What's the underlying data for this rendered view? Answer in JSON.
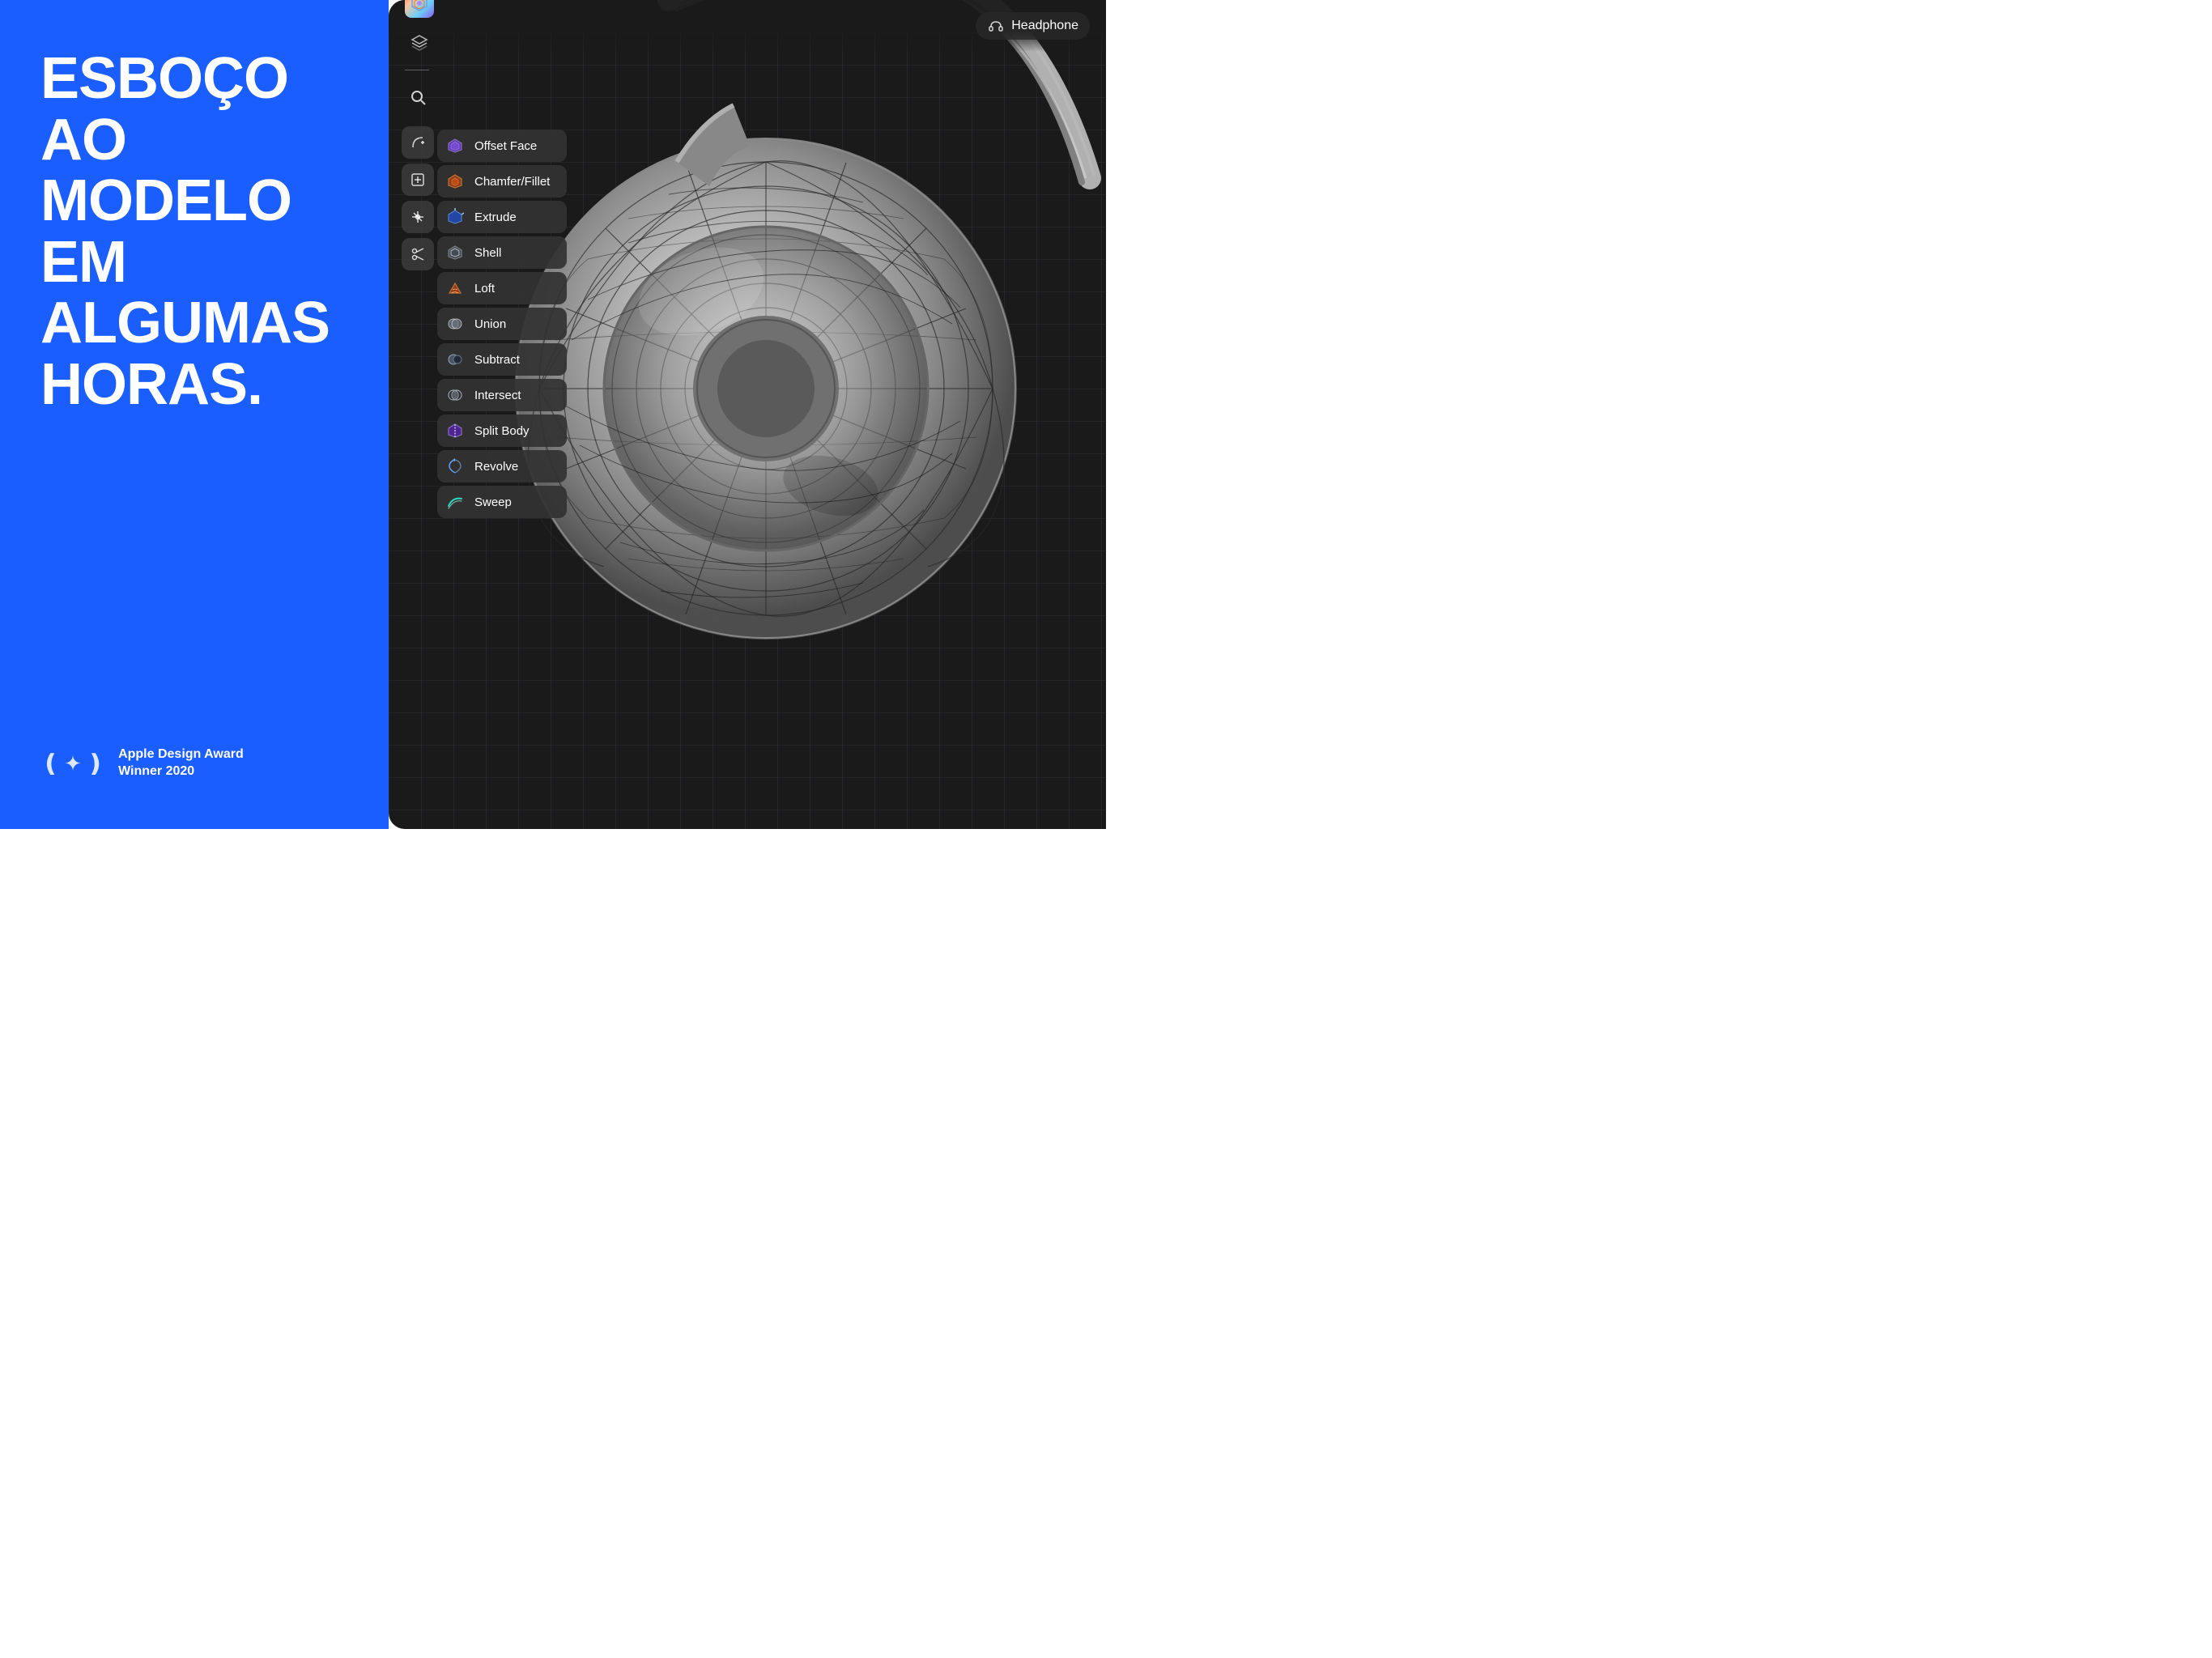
{
  "left": {
    "headline": "ESBOÇO AO MODELO EM ALGUMAS HORAS.",
    "award": {
      "title": "Apple Design Award",
      "subtitle": "Winner 2020"
    }
  },
  "right": {
    "app_icon": "◈",
    "layers_icon": "⊞",
    "model_name": "Headphone",
    "toolbar": {
      "search_label": "Search",
      "tools": [
        {
          "name": "add-constraint-tool",
          "label": "+"
        },
        {
          "name": "add-tool",
          "label": "+"
        },
        {
          "name": "transform-tool",
          "label": "✛"
        },
        {
          "name": "scissors-tool",
          "label": "✂"
        }
      ]
    },
    "menu_items": [
      {
        "id": "offset-face",
        "label": "Offset Face",
        "icon": "⬡",
        "icon_class": "icon-purple"
      },
      {
        "id": "chamfer-fillet",
        "label": "Chamfer/Fillet",
        "icon": "⬡",
        "icon_class": "icon-orange"
      },
      {
        "id": "extrude",
        "label": "Extrude",
        "icon": "⬡",
        "icon_class": "icon-blue"
      },
      {
        "id": "shell",
        "label": "Shell",
        "icon": "⬡",
        "icon_class": "icon-gray"
      },
      {
        "id": "loft",
        "label": "Loft",
        "icon": "⬡",
        "icon_class": "icon-orange"
      },
      {
        "id": "union",
        "label": "Union",
        "icon": "⬡",
        "icon_class": "icon-white"
      },
      {
        "id": "subtract",
        "label": "Subtract",
        "icon": "⬡",
        "icon_class": "icon-gray"
      },
      {
        "id": "intersect",
        "label": "Intersect",
        "icon": "⬡",
        "icon_class": "icon-gray"
      },
      {
        "id": "split-body",
        "label": "Split Body",
        "icon": "⬡",
        "icon_class": "icon-purple"
      },
      {
        "id": "revolve",
        "label": "Revolve",
        "icon": "⬡",
        "icon_class": "icon-blue"
      },
      {
        "id": "sweep",
        "label": "Sweep",
        "icon": "⬡",
        "icon_class": "icon-teal"
      }
    ]
  }
}
